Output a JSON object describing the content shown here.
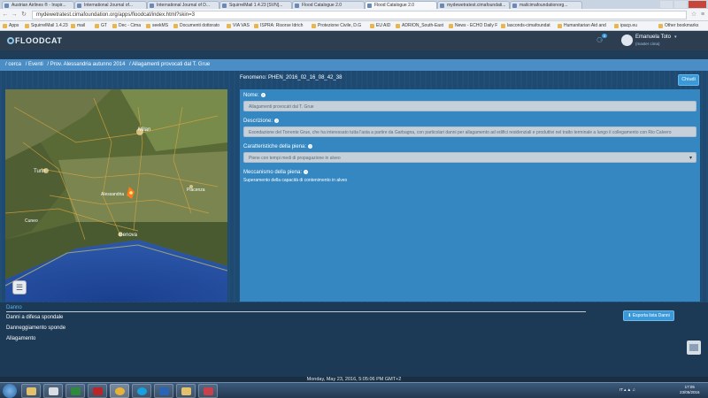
{
  "browser": {
    "tabs": [
      {
        "label": "Austrian Airlines ® - Inspir..."
      },
      {
        "label": "International Journal of..."
      },
      {
        "label": "International Journal of D..."
      },
      {
        "label": "SquirrelMail 1.4.23 [SVN]..."
      },
      {
        "label": "Flood Catalogue 2.0"
      },
      {
        "label": "Flood Catalogue 2.0"
      },
      {
        "label": "mydewetratest.cimafoundati..."
      },
      {
        "label": "mailcimafoundationorg..."
      }
    ],
    "url": "mydewetratest.cimafoundation.org/apps/floodcat/index.html?skin=3",
    "bookmarks": [
      "Apps",
      "SquirrelMail 1.4.23",
      "mail",
      "GT",
      "Dec - Cima",
      "seekMS",
      "Documenti dottorato",
      "VIA VAS",
      "ISPRA: Risorse Idrich",
      "Protezione Civile, D.G",
      "EU AID",
      "ADRION_South-East",
      "News - ECHO Daily F",
      "lasconds-cimafoundat",
      "Humanitarian Aid and",
      "ipacp.eu"
    ],
    "other_bookmarks": "Other bookmarks"
  },
  "header": {
    "logo": "FLOODCAT",
    "notification_count": "0",
    "user_name": "Emanuela Toto",
    "user_role": "(master cima)"
  },
  "breadcrumb": [
    "/ cerca",
    "/ Eventi",
    "/ Prov. Alessandria autunno 2014",
    "/ Allagamenti provocati dal T. Grue"
  ],
  "main": {
    "fenomeno": "Fenomeno: PHEN_2016_02_16_08_42_38",
    "close_label": "Chiudi",
    "map_labels": {
      "milano": "Milan",
      "torino": "Turin",
      "genova": "Genova",
      "piacenza": "Piacenza",
      "alessandria": "Alessandria",
      "cuneo": "Cuneo"
    },
    "form": {
      "nome_label": "Nome:",
      "nome_value": "Allagamenti provocati dal T. Grue",
      "descrizione_label": "Descrizione:",
      "descrizione_value": "Esondazione del Torrente Grue, che ha interessato tutta l'asta a partire da Garbagna, con particolari danni per allagamento ad edifici residenziali e produttivi nel tratto terminale a lungo il collegamento con Rio Calvero",
      "caratteristiche_label": "Caratteristiche della piena:",
      "caratteristiche_value": "Piene con tempi medi di propagazione in alveo",
      "meccanismo_label": "Meccanismo della piena:",
      "meccanismo_value": "Superamento della capacità di contenimento in alveo"
    }
  },
  "danni": {
    "title": "Danno",
    "items": [
      "Danni a difesa spondale",
      "Danneggiamento sponde",
      "Allagamento"
    ],
    "export_label": "Esporta lista Danni"
  },
  "status_bar": "Monday, May 23, 2016, 5:05:06 PM GMT+2",
  "taskbar": {
    "systray": "IT",
    "time": "17:05",
    "date": "23/05/2016"
  },
  "colors": {
    "accent": "#3a9ad9",
    "form_bg": "#3487c0",
    "breadcrumb_bg": "#4b8ec6",
    "header_bg": "#2c3e50"
  }
}
